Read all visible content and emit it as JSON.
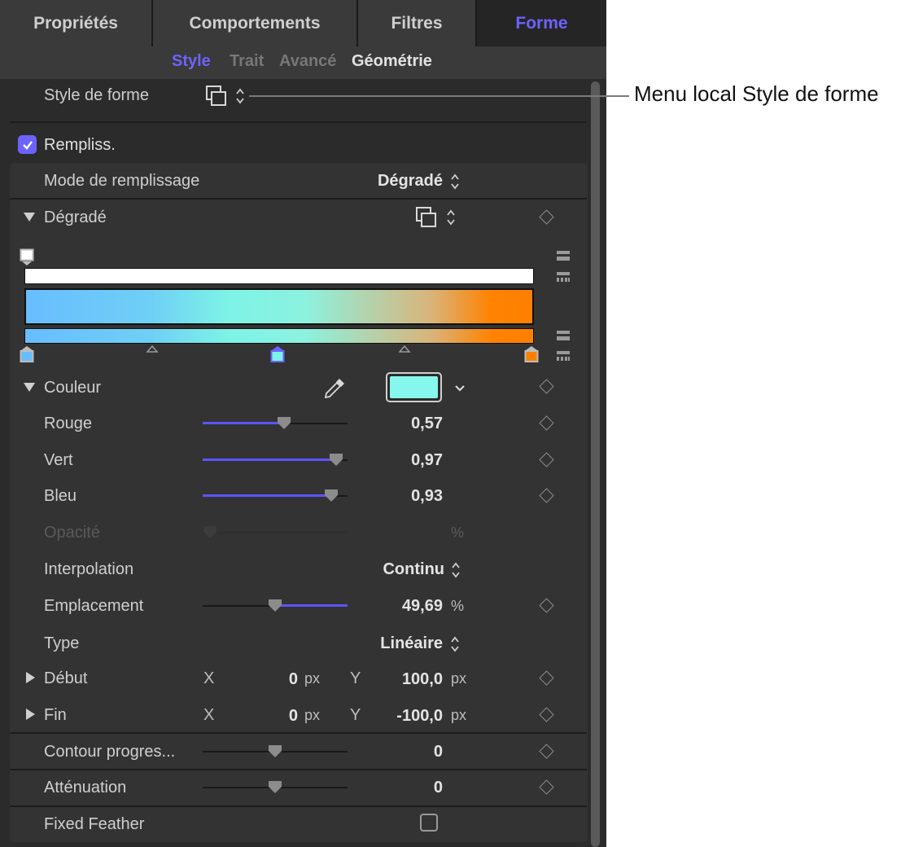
{
  "tabs": [
    {
      "label": "Propriétés",
      "active": false
    },
    {
      "label": "Comportements",
      "active": false
    },
    {
      "label": "Filtres",
      "active": false
    },
    {
      "label": "Forme",
      "active": true
    }
  ],
  "subtabs": [
    {
      "label": "Style",
      "state": "active"
    },
    {
      "label": "Trait",
      "state": "inactive"
    },
    {
      "label": "Avancé",
      "state": "inactive"
    },
    {
      "label": "Géométrie",
      "state": "bright"
    }
  ],
  "shape_style": {
    "label": "Style de forme",
    "icon": "shape-style-preset-icon"
  },
  "callout": {
    "text": "Menu local Style de forme"
  },
  "fill": {
    "label": "Rempliss.",
    "checked": true
  },
  "fill_mode": {
    "label": "Mode de remplissage",
    "value": "Dégradé"
  },
  "gradient": {
    "label": "Dégradé",
    "colors": [
      "#68bdff",
      "#7df3e6",
      "#ff8000"
    ],
    "stops": [
      {
        "color": "#68bdff",
        "location": 0
      },
      {
        "color": "#7df3e6",
        "location": 0.4969,
        "selected": true
      },
      {
        "color": "#ff8000",
        "location": 1
      }
    ],
    "opacity_stop": {
      "color": "#ffffff",
      "location": 0
    }
  },
  "color": {
    "label": "Couleur",
    "swatch": "#85f7ed",
    "eyedropper_icon": "eyedropper-icon"
  },
  "rouge": {
    "label": "Rouge",
    "value": "0,57",
    "level": 0.57
  },
  "vert": {
    "label": "Vert",
    "value": "0,97",
    "level": 0.97
  },
  "bleu": {
    "label": "Bleu",
    "value": "0,93",
    "level": 0.93
  },
  "opacite": {
    "label": "Opacité",
    "unit": "%",
    "level": 0
  },
  "interpolation": {
    "label": "Interpolation",
    "value": "Continu"
  },
  "emplacement": {
    "label": "Emplacement",
    "value": "49,69",
    "unit": "%",
    "level": 0.4969
  },
  "type": {
    "label": "Type",
    "value": "Linéaire"
  },
  "debut": {
    "label": "Début",
    "x_label": "X",
    "x_value": "0",
    "x_unit": "px",
    "y_label": "Y",
    "y_value": "100,0",
    "y_unit": "px"
  },
  "fin": {
    "label": "Fin",
    "x_label": "X",
    "x_value": "0",
    "x_unit": "px",
    "y_label": "Y",
    "y_value": "-100,0",
    "y_unit": "px"
  },
  "contour": {
    "label": "Contour progres...",
    "value": "0",
    "level": 0.5
  },
  "attenuation": {
    "label": "Atténuation",
    "value": "0",
    "level": 0.5
  },
  "fixed_feather": {
    "label": "Fixed Feather",
    "checked": false
  }
}
